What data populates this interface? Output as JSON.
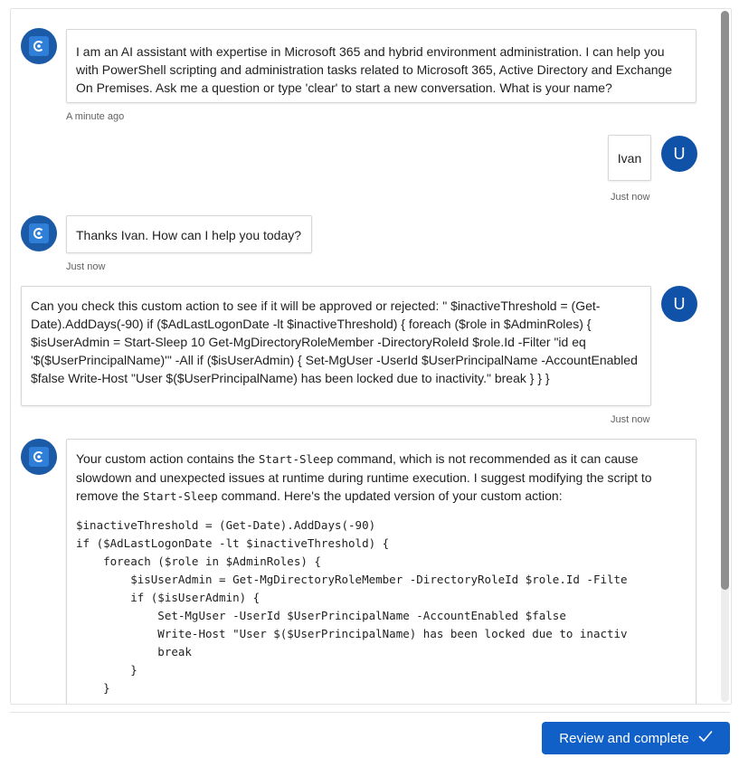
{
  "colors": {
    "accent": "#1160c8",
    "user_avatar": "#0f52a8",
    "bot_avatar": "#1a5aa6"
  },
  "messages": [
    {
      "role": "assistant",
      "text": "I am an AI assistant with expertise in Microsoft 365 and hybrid environment administration. I can help you with PowerShell scripting and administration tasks related to Microsoft 365, Active Directory and Exchange On Premises. Ask me a question or type 'clear' to start a new conversation. What is your name?",
      "time": "A minute ago"
    },
    {
      "role": "user",
      "avatar_letter": "U",
      "text": "Ivan",
      "time": "Just now"
    },
    {
      "role": "assistant",
      "text": "Thanks Ivan. How can I help you today?",
      "time": "Just now"
    },
    {
      "role": "user",
      "avatar_letter": "U",
      "text": "Can you check this custom action to see if it will be approved or rejected: \" $inactiveThreshold = (Get-Date).AddDays(-90) if ($AdLastLogonDate -lt $inactiveThreshold) { foreach ($role in $AdminRoles) { $isUserAdmin = Start-Sleep 10 Get-MgDirectoryRoleMember -DirectoryRoleId $role.Id -Filter \"id eq '$($UserPrincipalName)'\" -All if ($isUserAdmin) { Set-MgUser -UserId $UserPrincipalName -AccountEnabled $false Write-Host \"User $($UserPrincipalName) has been locked due to inactivity.\" break } } }",
      "time": "Just now"
    },
    {
      "role": "assistant",
      "intro": {
        "p1": "Your custom action contains the ",
        "code1": "Start-Sleep",
        "p2": " command, which is not recommended as it can cause slowdown and unexpected issues at runtime during runtime execution. I suggest modifying the script to remove the ",
        "code2": "Start-Sleep",
        "p3": " command. Here's the updated version of your custom action:"
      },
      "code": "$inactiveThreshold = (Get-Date).AddDays(-90)\nif ($AdLastLogonDate -lt $inactiveThreshold) {\n    foreach ($role in $AdminRoles) {\n        $isUserAdmin = Get-MgDirectoryRoleMember -DirectoryRoleId $role.Id -Filte\n        if ($isUserAdmin) {\n            Set-MgUser -UserId $UserPrincipalName -AccountEnabled $false\n            Write-Host \"User $($UserPrincipalName) has been locked due to inactiv\n            break\n        }\n    }"
    }
  ],
  "footer": {
    "review_label": "Review and complete",
    "review_icon": "checkmark-icon"
  }
}
